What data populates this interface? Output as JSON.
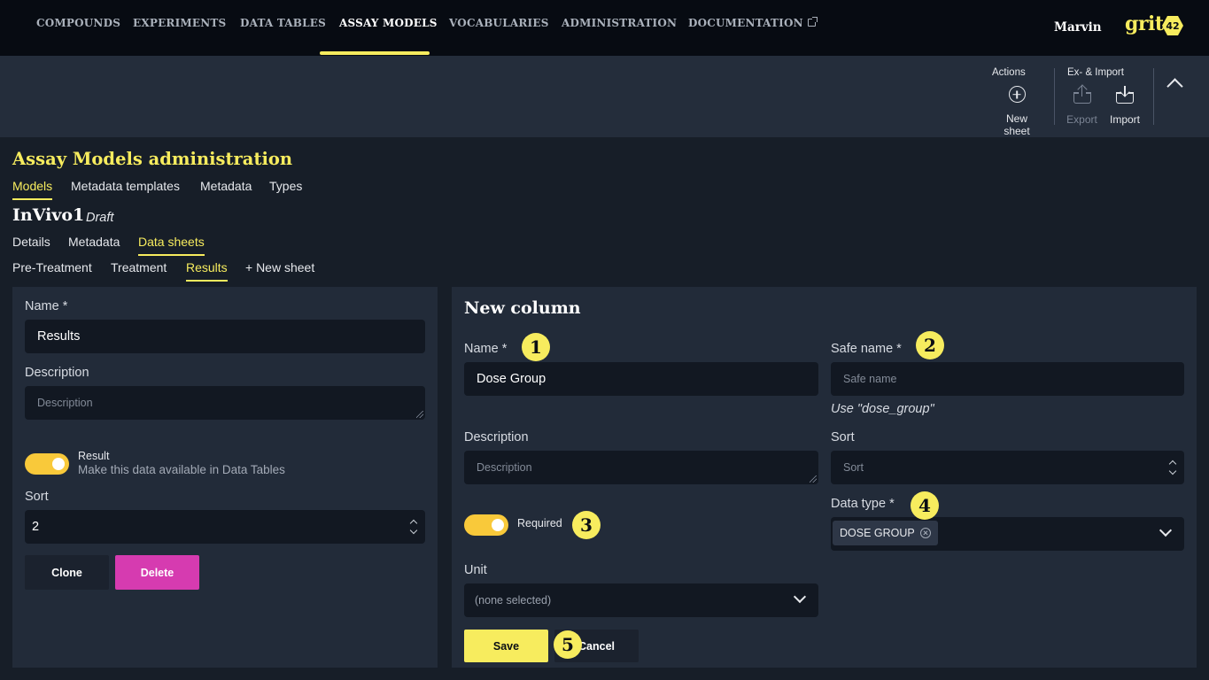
{
  "nav": {
    "items": [
      "COMPOUNDS",
      "EXPERIMENTS",
      "DATA TABLES",
      "ASSAY MODELS",
      "VOCABULARIES",
      "ADMINISTRATION",
      "DOCUMENTATION"
    ],
    "active": "ASSAY MODELS",
    "user": "Marvin",
    "logo_text": "grit",
    "logo_badge": "42"
  },
  "toolbar": {
    "actions_label": "Actions",
    "new_sheet_label": "New sheet",
    "ex_import_label": "Ex- & Import",
    "export_label": "Export",
    "import_label": "Import",
    "export_disabled": true
  },
  "page": {
    "title": "Assay Models administration",
    "tabs": [
      "Models",
      "Metadata templates",
      "Metadata",
      "Types"
    ],
    "active_tab": "Models"
  },
  "model": {
    "name": "InVivo1",
    "status": "Draft",
    "tabs": [
      "Details",
      "Metadata",
      "Data sheets"
    ],
    "active_tab": "Data sheets",
    "sheet_tabs": [
      "Pre-Treatment",
      "Treatment",
      "Results",
      "+ New sheet"
    ],
    "active_sheet": "Results"
  },
  "sheet_form": {
    "name_label": "Name *",
    "name_value": "Results",
    "description_label": "Description",
    "description_placeholder": "Description",
    "result_toggle_label": "Result",
    "result_toggle_on": true,
    "result_toggle_hint": "Make this data available in Data Tables",
    "sort_label": "Sort",
    "sort_value": "2",
    "clone_label": "Clone",
    "delete_label": "Delete"
  },
  "column_form": {
    "title": "New column",
    "name_label": "Name *",
    "name_value": "Dose Group",
    "safe_name_label": "Safe name *",
    "safe_name_placeholder": "Safe name",
    "safe_name_hint": "Use \"dose_group\"",
    "description_label": "Description",
    "description_placeholder": "Description",
    "sort_label": "Sort",
    "sort_placeholder": "Sort",
    "required_label": "Required",
    "required_on": true,
    "data_type_label": "Data type *",
    "data_type_value": "DOSE GROUP",
    "unit_label": "Unit",
    "unit_value": "(none selected)",
    "save_label": "Save",
    "cancel_label": "Cancel"
  },
  "callouts": [
    "1",
    "2",
    "3",
    "4",
    "5"
  ],
  "colors": {
    "accent": "#f7ec5e",
    "toggle": "#f9c93a",
    "delete": "#d63bb0",
    "nav_bg": "#070b12",
    "panel_bg": "#222b39"
  }
}
